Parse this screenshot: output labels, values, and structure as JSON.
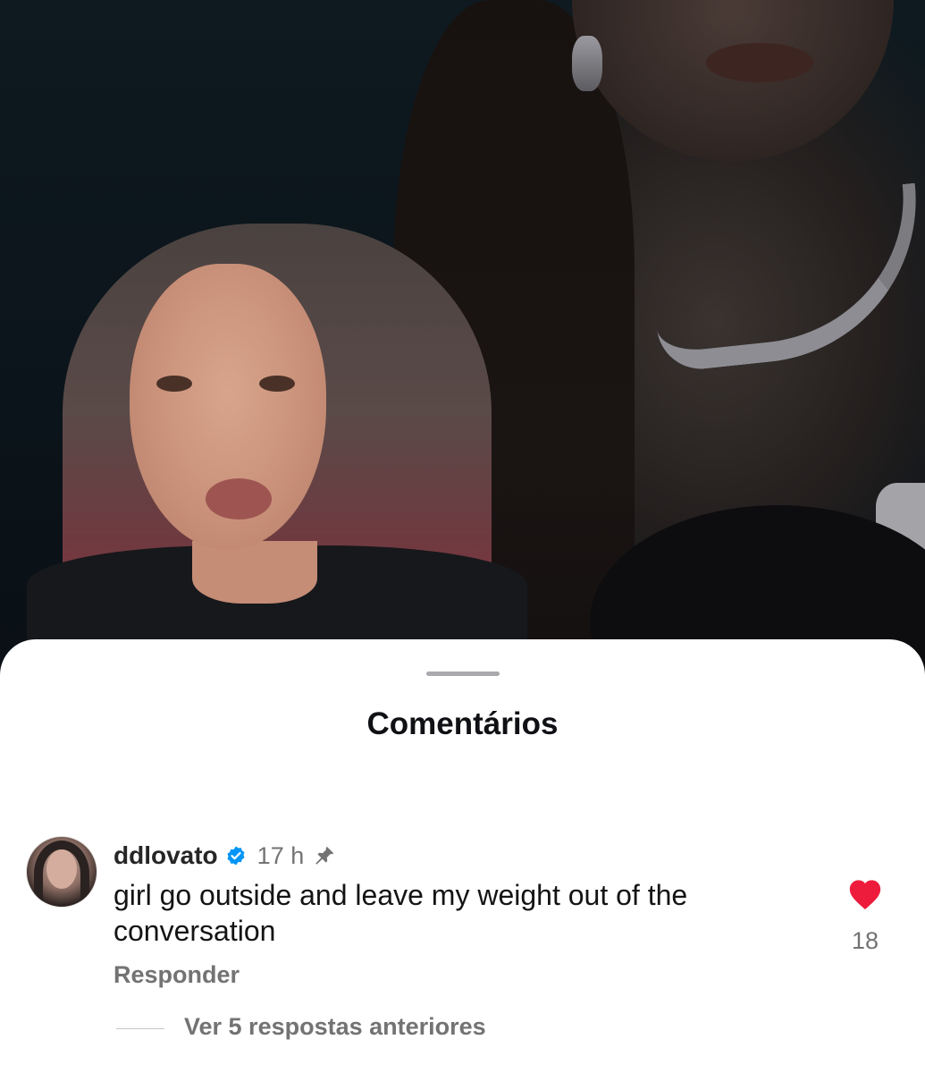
{
  "sheet": {
    "title": "Comentários"
  },
  "comment": {
    "username": "ddlovato",
    "verified_icon": "verified-badge-icon",
    "time": "17 h",
    "pinned_icon": "pin-icon",
    "text": "girl go outside and leave my weight out of the conversation",
    "likes": "18",
    "like_icon": "heart-icon",
    "liked": true,
    "reply_label": "Responder",
    "view_replies_label": "Ver 5 respostas anteriores"
  },
  "colors": {
    "heart": "#ed1c3c",
    "verified": "#0095f6",
    "secondary_text": "#737373"
  }
}
